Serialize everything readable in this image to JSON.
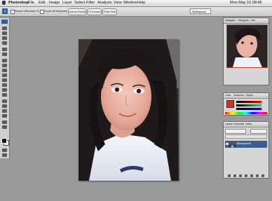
{
  "app": {
    "name": "Photoshop"
  },
  "menu": {
    "items": [
      "File",
      "Edit",
      "Image",
      "Layer",
      "Select",
      "Filter",
      "Analysis",
      "View",
      "Window",
      "Help"
    ],
    "clock": "Mon May 10 08:46"
  },
  "options_bar": {
    "resize_windows_label": "Resize Windows To Fit",
    "zoom_all_windows_label": "Zoom All Windows",
    "actual_pixels_label": "Actual Pixels",
    "fit_screen_label": "Fit Screen",
    "print_size_label": "Print Size",
    "workspace_label": "Workspace"
  },
  "navigator": {
    "tabs": [
      "Navigator",
      "Histogram",
      "Info"
    ]
  },
  "color_panel": {
    "tabs": [
      "Color",
      "Swatches",
      "Styles"
    ],
    "fg_color": "#c0392b"
  },
  "layers_panel": {
    "tabs": [
      "Layers",
      "Channels",
      "Paths"
    ],
    "layer_name": "Background"
  },
  "colors": {
    "accent": "#2d5e9e",
    "selected_layer": "#3c5f92"
  }
}
